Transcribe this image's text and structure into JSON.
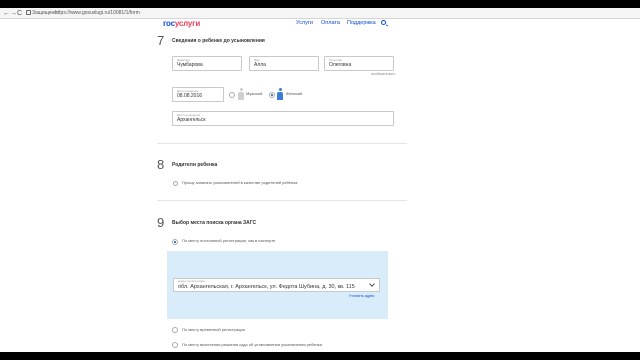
{
  "browser": {
    "back": "←",
    "forward": "→",
    "reload": "C",
    "secure_label": "Защищено",
    "url": "https://www.gosuslugi.ru/10081/1/form"
  },
  "header": {
    "logo_gos": "гос",
    "logo_uslugi": "услуги",
    "nav": [
      "Услуги",
      "Оплата",
      "Поддержка"
    ]
  },
  "section7": {
    "number": "7",
    "title": "Сведения о ребенке до усыновления",
    "surname": {
      "label": "Фамилия",
      "value": "Чумбарова"
    },
    "name": {
      "label": "Имя",
      "value": "Алла"
    },
    "patronymic": {
      "label": "Отчество",
      "value": "Олеговна"
    },
    "patronymic_hint": "необязательно",
    "birthdate": {
      "label": "Дата рождения",
      "value": "08.08.2016"
    },
    "gender_male": "Мужской",
    "gender_female": "Женский",
    "birthplace": {
      "label": "Место рождения",
      "value": "Архангельск"
    }
  },
  "section8": {
    "number": "8",
    "title": "Родители ребенка",
    "checkbox_label": "Прошу записать усыновителей в качестве родителей ребенка"
  },
  "section9": {
    "number": "9",
    "title": "Выбор места поиска органа ЗАГС",
    "option1": "По месту постоянной регистрации, как в паспорте",
    "address": {
      "label": "Адрес регистрации",
      "value": "обл. Архангельская, г. Архангельск, ул. Федота Шубина, д. 30, кв. 115",
      "clarify": "Уточнить адрес"
    },
    "option2": "По месту временной регистрации",
    "option3": "По месту вынесения решения суда об установлении усыновления ребенка"
  }
}
